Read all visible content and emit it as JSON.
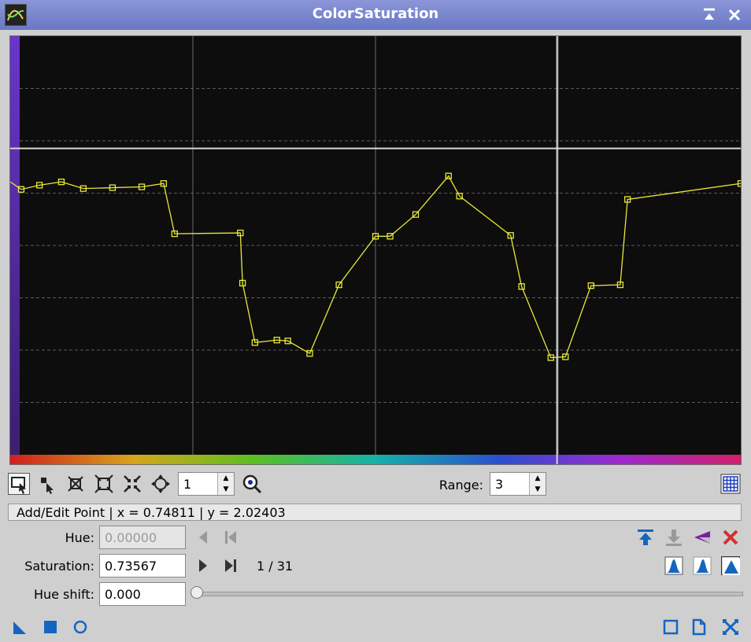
{
  "window": {
    "title": "ColorSaturation"
  },
  "toolbar": {
    "zoom_value": "1",
    "range_label": "Range:",
    "range_value": "3",
    "tools": [
      "edit-point-tool",
      "select-tool",
      "delete-point-tool",
      "zoom-in-tool",
      "zoom-out-tool",
      "pan-tool",
      "zoom-readout-icon"
    ]
  },
  "status": {
    "text": "Add/Edit Point | x = 0.74811 | y = 2.02403"
  },
  "editor": {
    "hue_label": "Hue:",
    "hue_value": "0.00000",
    "saturation_label": "Saturation:",
    "saturation_value": "0.73567",
    "point_counter": "1 / 31",
    "hue_shift_label": "Hue shift:",
    "hue_shift_value": "0.000"
  },
  "chart_data": {
    "type": "line",
    "xlim": [
      0,
      1
    ],
    "ylim": [
      -1,
      4
    ],
    "grid": true,
    "series_color": "#e8e83a",
    "x": [
      0.0,
      0.015,
      0.04,
      0.07,
      0.1,
      0.14,
      0.18,
      0.21,
      0.225,
      0.315,
      0.318,
      0.335,
      0.365,
      0.38,
      0.41,
      0.45,
      0.5,
      0.52,
      0.555,
      0.6,
      0.615,
      0.685,
      0.7,
      0.74,
      0.76,
      0.795,
      0.835,
      0.845,
      1.0
    ],
    "y": [
      2.26,
      2.17,
      2.22,
      2.26,
      2.18,
      2.19,
      2.2,
      2.24,
      1.64,
      1.65,
      1.05,
      0.34,
      0.37,
      0.36,
      0.21,
      1.03,
      1.61,
      1.61,
      1.87,
      2.33,
      2.09,
      1.62,
      1.01,
      0.16,
      0.17,
      1.02,
      1.03,
      2.05,
      2.24
    ]
  },
  "colors": {
    "titlebar": "#7a86cc",
    "graph_bg": "#0d0d0d",
    "curve": "#e8e83a",
    "accent": "#1565c0",
    "delete": "#d32f2f"
  }
}
